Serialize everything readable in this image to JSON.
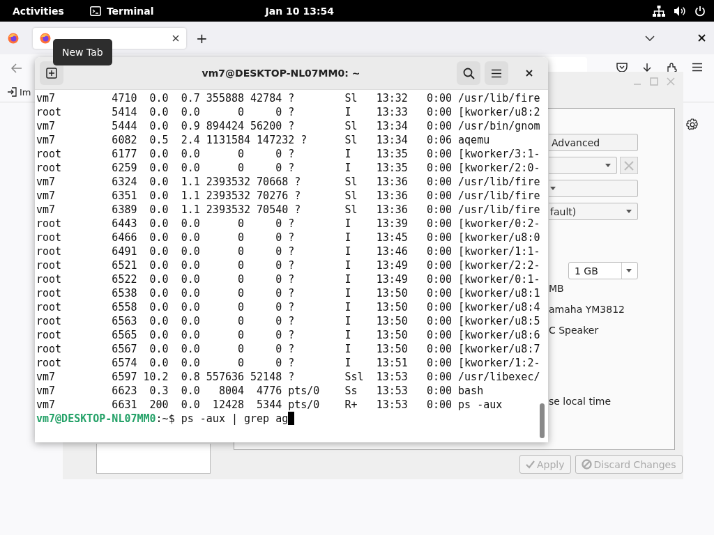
{
  "top_bar": {
    "activities": "Activities",
    "app_name": "Terminal",
    "clock": "Jan 10  13:54"
  },
  "browser": {
    "tabs": [
      {
        "selected": true
      }
    ],
    "new_tab_button": "+",
    "tooltip": "New Tab",
    "bookmark": "Im"
  },
  "dialog": {
    "advanced_button": "Advanced",
    "combo_3": "fault)",
    "memory_combo": "1 GB",
    "memory_unit": "MB",
    "sound_options": [
      "amaha YM3812",
      "C Speaker"
    ],
    "clock_option": "se local time",
    "buttons": [
      {
        "label": "Apply",
        "kind": "apply",
        "disabled": true
      },
      {
        "label": "Discard Changes",
        "kind": "discard",
        "disabled": true
      }
    ]
  },
  "terminal": {
    "title": "vm7@DESKTOP-NL07MM0: ~",
    "lines": [
      "vm7         4710  0.0  0.7 355888 42784 ?        Sl   13:32   0:00 /usr/lib/fire",
      "root        5414  0.0  0.0      0     0 ?        I    13:33   0:00 [kworker/u8:2",
      "vm7         5444  0.0  0.9 894424 56200 ?        Sl   13:34   0:00 /usr/bin/gnom",
      "vm7         6082  0.5  2.4 1131584 147232 ?      Sl   13:34   0:06 aqemu",
      "root        6177  0.0  0.0      0     0 ?        I    13:35   0:00 [kworker/3:1-",
      "root        6259  0.0  0.0      0     0 ?        I    13:35   0:00 [kworker/2:0-",
      "vm7         6324  0.0  1.1 2393532 70668 ?       Sl   13:36   0:00 /usr/lib/fire",
      "vm7         6351  0.0  1.1 2393532 70276 ?       Sl   13:36   0:00 /usr/lib/fire",
      "vm7         6389  0.0  1.1 2393532 70540 ?       Sl   13:36   0:00 /usr/lib/fire",
      "root        6443  0.0  0.0      0     0 ?        I    13:39   0:00 [kworker/0:2-",
      "root        6466  0.0  0.0      0     0 ?        I    13:45   0:00 [kworker/u8:0",
      "root        6491  0.0  0.0      0     0 ?        I    13:46   0:00 [kworker/1:1-",
      "root        6521  0.0  0.0      0     0 ?        I    13:49   0:00 [kworker/2:2-",
      "root        6522  0.0  0.0      0     0 ?        I    13:49   0:00 [kworker/0:1-",
      "root        6538  0.0  0.0      0     0 ?        I    13:50   0:00 [kworker/u8:1",
      "root        6558  0.0  0.0      0     0 ?        I    13:50   0:00 [kworker/u8:4",
      "root        6563  0.0  0.0      0     0 ?        I    13:50   0:00 [kworker/u8:5",
      "root        6565  0.0  0.0      0     0 ?        I    13:50   0:00 [kworker/u8:6",
      "root        6567  0.0  0.0      0     0 ?        I    13:50   0:00 [kworker/u8:7",
      "root        6574  0.0  0.0      0     0 ?        I    13:51   0:00 [kworker/1:2-",
      "vm7         6597 10.2  0.8 557636 52148 ?        Ssl  13:53   0:00 /usr/libexec/",
      "vm7         6623  0.3  0.0   8004  4776 pts/0    Ss   13:53   0:00 bash",
      "vm7         6631  200  0.0  12428  5344 pts/0    R+   13:53   0:00 ps -aux"
    ],
    "prompt_host": "vm7@DESKTOP-NL07MM0",
    "prompt_rest": ":~$ ps -aux | grep ag"
  }
}
